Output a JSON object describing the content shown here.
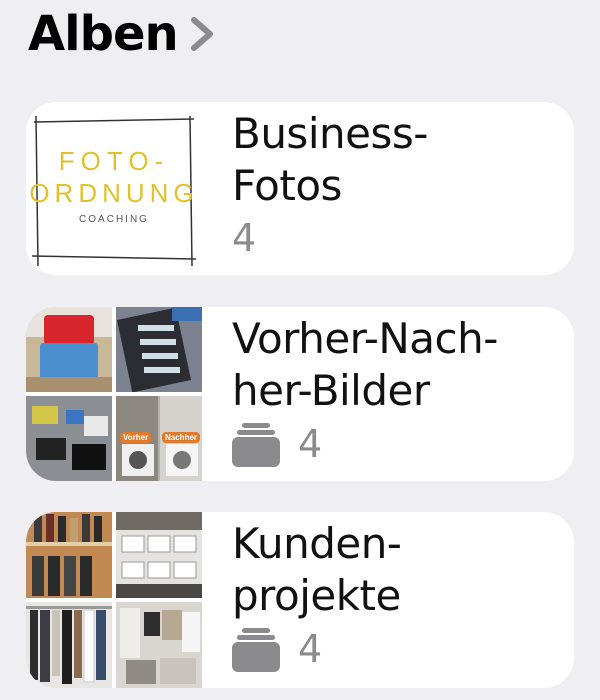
{
  "header": {
    "title": "Alben"
  },
  "albums": [
    {
      "title": "Business-\nFotos",
      "count": "4",
      "thumbnail": {
        "type": "logo",
        "logo_text": [
          "FOTO-",
          "ORDNUNG",
          "COACHING"
        ]
      }
    },
    {
      "title": "Vorher-Nach-\nher-Bilder",
      "count": "4",
      "icon": "stacked-albums-icon",
      "thumbnail": {
        "type": "photo-grid",
        "tags": [
          "Vorher",
          "Nachher"
        ]
      }
    },
    {
      "title": "Kunden-\nprojekte",
      "count": "4",
      "icon": "stacked-albums-icon",
      "thumbnail": {
        "type": "photo-grid"
      }
    }
  ],
  "colors": {
    "background": "#eeeef3",
    "card": "#ffffff",
    "count_text": "#8b8b8f",
    "logo_yellow": "#e2c12c"
  }
}
